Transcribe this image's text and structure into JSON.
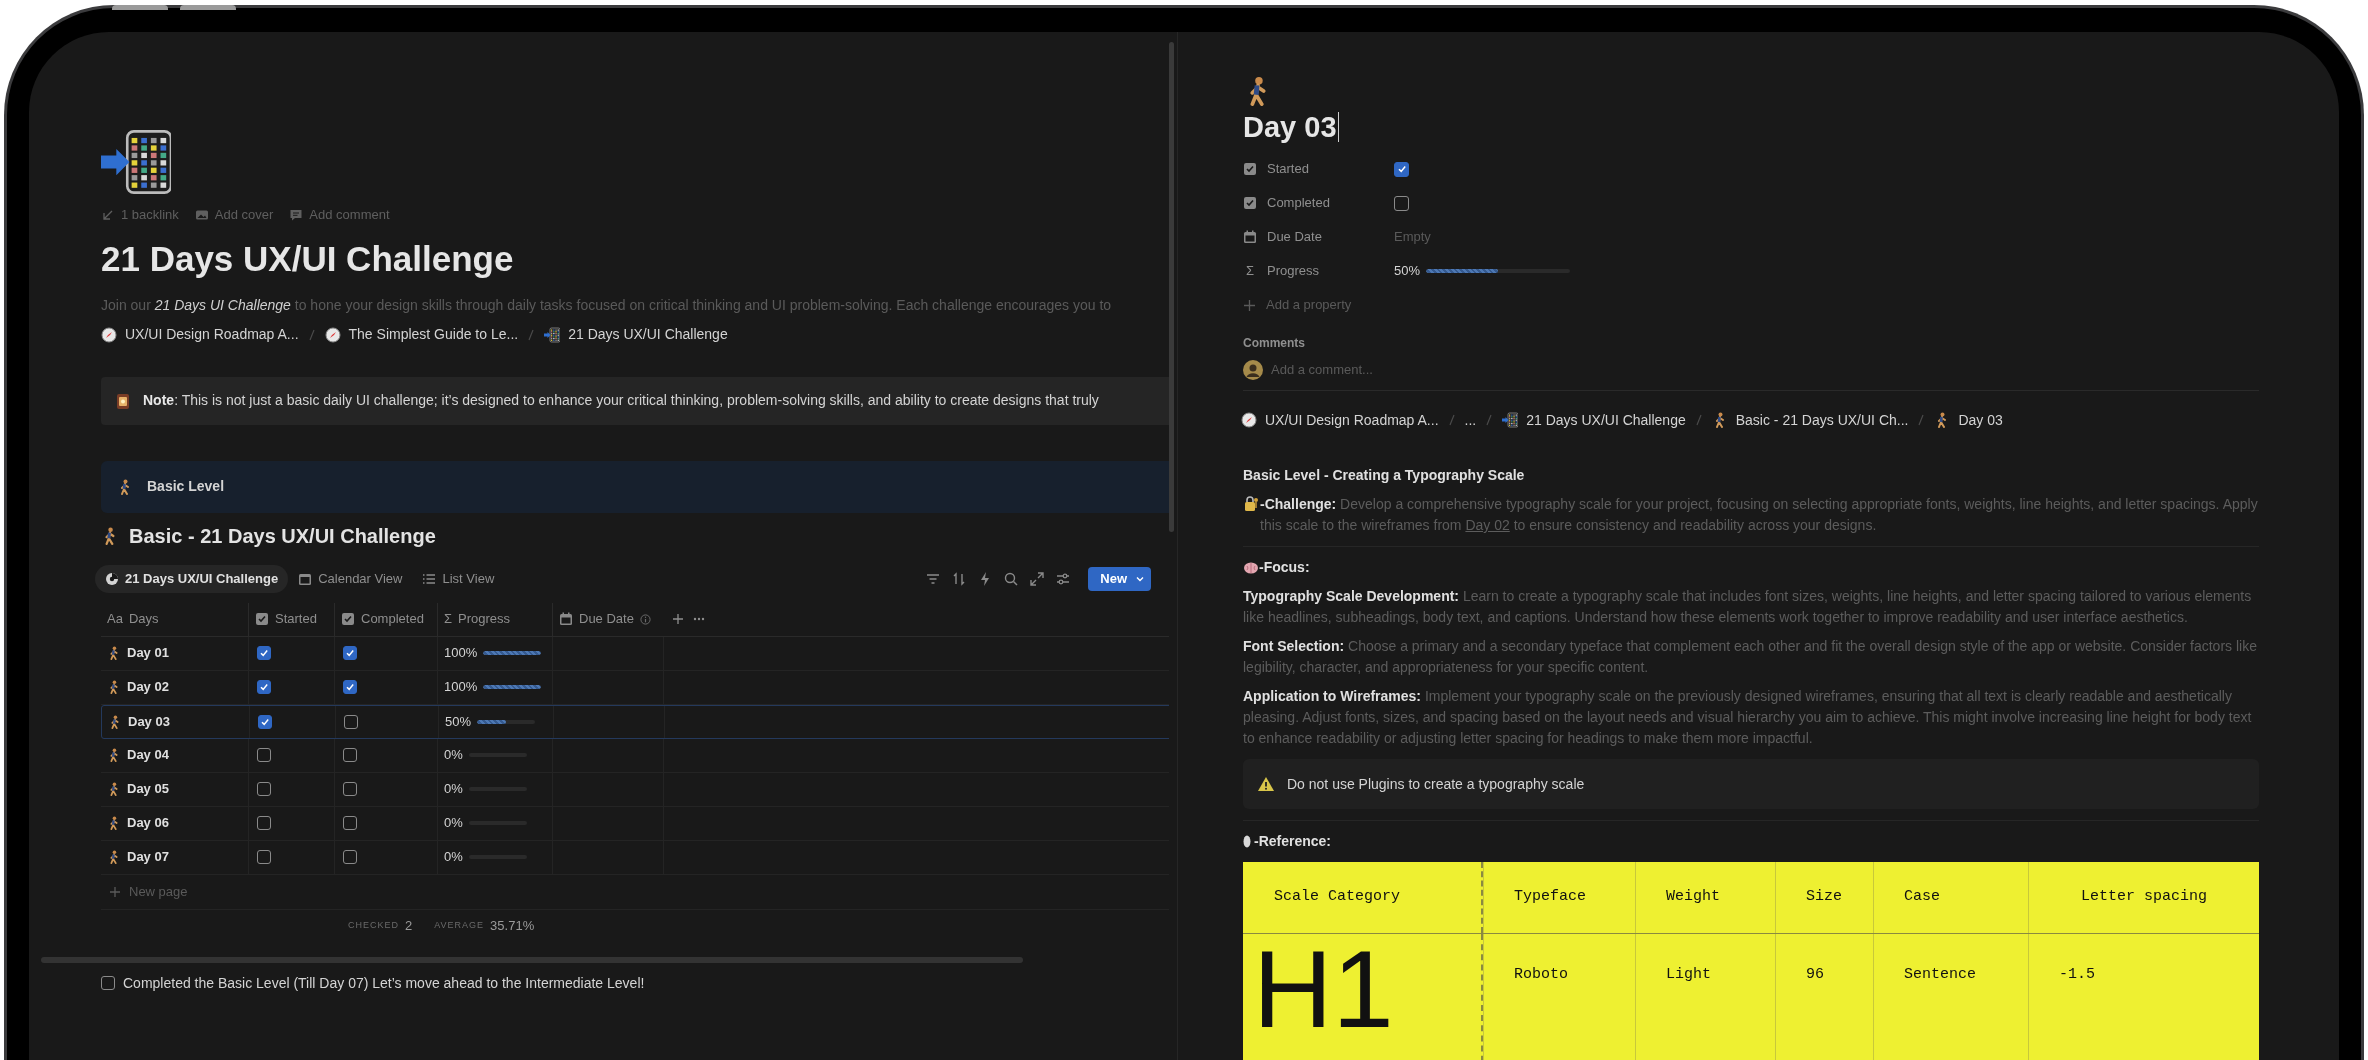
{
  "left": {
    "meta": [
      {
        "kind": "backlink",
        "label": "1 backlink"
      },
      {
        "kind": "cover",
        "label": "Add cover"
      },
      {
        "kind": "comment",
        "label": "Add comment"
      }
    ],
    "title": "21 Days UX/UI Challenge",
    "description": "Join our *21 Days UI Challenge* to hone your design skills through daily tasks focused on critical thinking and UI problem-solving. Each challenge encourages you to",
    "breadcrumbs": [
      {
        "kind": "guide",
        "label": "UX/UI Design Roadmap A..."
      },
      {
        "kind": "guide",
        "label": "The Simplest Guide to Le..."
      },
      {
        "kind": "hub",
        "label": "21 Days UX/UI Challenge"
      }
    ],
    "note": "**Note**: This is not just a basic daily UI challenge; it’s designed to enhance your critical thinking, problem-solving skills, and ability to create designs that truly",
    "toggle_heading": "Basic Level",
    "database_title": "Basic - 21 Days UX/UI Challenge",
    "views": [
      {
        "kind": "chart",
        "label": "21 Days UX/UI Challenge",
        "selected": true
      },
      {
        "kind": "calendar",
        "label": "Calendar View",
        "selected": false
      },
      {
        "kind": "list",
        "label": "List View",
        "selected": false
      }
    ],
    "new_button": "New",
    "columns": [
      {
        "kind": "title",
        "glyph": "Aa",
        "label": "Days"
      },
      {
        "kind": "checkbox",
        "label": "Started"
      },
      {
        "kind": "checkbox",
        "label": "Completed"
      },
      {
        "kind": "formula",
        "glyph": "Σ",
        "label": "Progress"
      },
      {
        "kind": "date",
        "label": "Due Date"
      }
    ],
    "rows": [
      {
        "name": "Day 01",
        "started": true,
        "completed": true,
        "progress": "100%",
        "level": 1,
        "selected": false
      },
      {
        "name": "Day 02",
        "started": true,
        "completed": true,
        "progress": "100%",
        "level": 1,
        "selected": false
      },
      {
        "name": "Day 03",
        "started": true,
        "completed": false,
        "progress": "50%",
        "level": 0.5,
        "selected": true
      },
      {
        "name": "Day 04",
        "started": false,
        "completed": false,
        "progress": "0%",
        "level": 0,
        "selected": false
      },
      {
        "name": "Day 05",
        "started": false,
        "completed": false,
        "progress": "0%",
        "level": 0,
        "selected": false
      },
      {
        "name": "Day 06",
        "started": false,
        "completed": false,
        "progress": "0%",
        "level": 0,
        "selected": false
      },
      {
        "name": "Day 07",
        "started": false,
        "completed": false,
        "progress": "0%",
        "level": 0,
        "selected": false
      }
    ],
    "new_page": "New page",
    "footer": [
      {
        "label": "CHECKED",
        "value": "2"
      },
      {
        "label": "AVERAGE",
        "value": "35.71%"
      }
    ],
    "todo": {
      "text": "Completed the Basic Level (Till Day 07) Let’s move ahead to the Intermediate Level!",
      "checked": false
    }
  },
  "right": {
    "title": "Day 03",
    "properties": [
      {
        "kind": "checkbox",
        "label": "Started",
        "checked": true
      },
      {
        "kind": "checkbox",
        "label": "Completed",
        "checked": false
      },
      {
        "kind": "date",
        "label": "Due Date",
        "value": "Empty"
      },
      {
        "kind": "formula",
        "glyph": "Σ",
        "label": "Progress",
        "value": "50%",
        "level": 0.5
      }
    ],
    "add_property": "Add a property",
    "comments_label": "Comments",
    "comment_placeholder": "Add a comment...",
    "breadcrumbs": [
      {
        "kind": "guide",
        "label": "UX/UI Design Roadmap A..."
      },
      {
        "kind": "collapsed",
        "label": "..."
      },
      {
        "kind": "hub",
        "label": "21 Days UX/UI Challenge"
      },
      {
        "kind": "level",
        "label": "Basic - 21 Days UX/UI Ch..."
      },
      {
        "kind": "level",
        "label": "Day 03"
      }
    ],
    "heading": "Basic Level - Creating a Typography Scale",
    "challenge": {
      "text": "**-Challenge:** Develop a comprehensive typography scale for your project, focusing on selecting appropriate fonts, weights, line heights, and letter spacings. Apply this scale to the wireframes from ",
      "link": "Day 02",
      "text_after": " to ensure consistency and readability across your designs."
    },
    "focus_heading": "-Focus:",
    "focus": [
      "**Typography Scale Development:** Learn to create a typography scale that includes font sizes, weights, line heights, and letter spacing tailored to various elements like headlines, subheadings, body text, and captions. Understand how these elements work together to improve readability and user interface aesthetics.",
      "**Font Selection:** Choose a primary and a secondary typeface that complement each other and fit the overall design style of the app or website. Consider factors like legibility, character, and appropriateness for your specific content.",
      "**Application to Wireframes:** Implement your typography scale on the previously designed wireframes, ensuring that all text is clearly readable and aesthetically pleasing. Adjust fonts, sizes, and spacing based on the layout needs and visual hierarchy you aim to achieve. This might involve increasing line height for body text to enhance readability or adjusting letter spacing for headings to make them more impactful."
    ],
    "warning": "Do not use Plugins to create a typography scale",
    "reference_heading": "-Reference:",
    "reference_table": {
      "columns": [
        "Scale Category",
        "Typeface",
        "Weight",
        "Size",
        "Case",
        "Letter spacing"
      ],
      "rows": [
        [
          "H1",
          "Roboto",
          "Light",
          "96",
          "Sentence",
          "-1.5"
        ]
      ]
    }
  }
}
